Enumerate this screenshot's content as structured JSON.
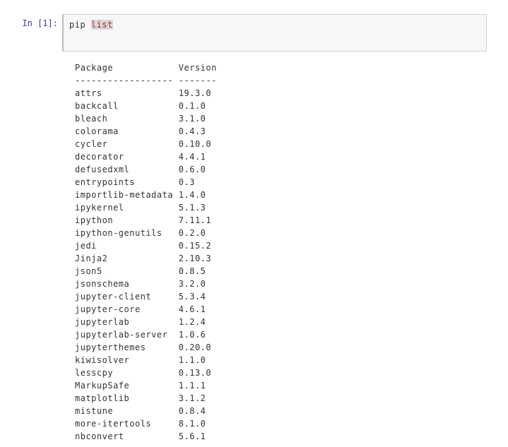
{
  "prompt": {
    "label": "In",
    "count": "[1]:"
  },
  "code": {
    "cmd": "pip ",
    "arg": "list"
  },
  "output": {
    "header_pkg": "Package",
    "header_ver": "Version",
    "rule_pkg": "------------------",
    "rule_ver": "-------",
    "rows": [
      {
        "pkg": "attrs",
        "ver": "19.3.0"
      },
      {
        "pkg": "backcall",
        "ver": "0.1.0"
      },
      {
        "pkg": "bleach",
        "ver": "3.1.0"
      },
      {
        "pkg": "colorama",
        "ver": "0.4.3"
      },
      {
        "pkg": "cycler",
        "ver": "0.10.0"
      },
      {
        "pkg": "decorator",
        "ver": "4.4.1"
      },
      {
        "pkg": "defusedxml",
        "ver": "0.6.0"
      },
      {
        "pkg": "entrypoints",
        "ver": "0.3"
      },
      {
        "pkg": "importlib-metadata",
        "ver": "1.4.0"
      },
      {
        "pkg": "ipykernel",
        "ver": "5.1.3"
      },
      {
        "pkg": "ipython",
        "ver": "7.11.1"
      },
      {
        "pkg": "ipython-genutils",
        "ver": "0.2.0"
      },
      {
        "pkg": "jedi",
        "ver": "0.15.2"
      },
      {
        "pkg": "Jinja2",
        "ver": "2.10.3"
      },
      {
        "pkg": "json5",
        "ver": "0.8.5"
      },
      {
        "pkg": "jsonschema",
        "ver": "3.2.0"
      },
      {
        "pkg": "jupyter-client",
        "ver": "5.3.4"
      },
      {
        "pkg": "jupyter-core",
        "ver": "4.6.1"
      },
      {
        "pkg": "jupyterlab",
        "ver": "1.2.4"
      },
      {
        "pkg": "jupyterlab-server",
        "ver": "1.0.6"
      },
      {
        "pkg": "jupyterthemes",
        "ver": "0.20.0"
      },
      {
        "pkg": "kiwisolver",
        "ver": "1.1.0"
      },
      {
        "pkg": "lesscpy",
        "ver": "0.13.0"
      },
      {
        "pkg": "MarkupSafe",
        "ver": "1.1.1"
      },
      {
        "pkg": "matplotlib",
        "ver": "3.1.2"
      },
      {
        "pkg": "mistune",
        "ver": "0.8.4"
      },
      {
        "pkg": "more-itertools",
        "ver": "8.1.0"
      },
      {
        "pkg": "nbconvert",
        "ver": "5.6.1"
      }
    ],
    "pkg_col_width": 19
  }
}
